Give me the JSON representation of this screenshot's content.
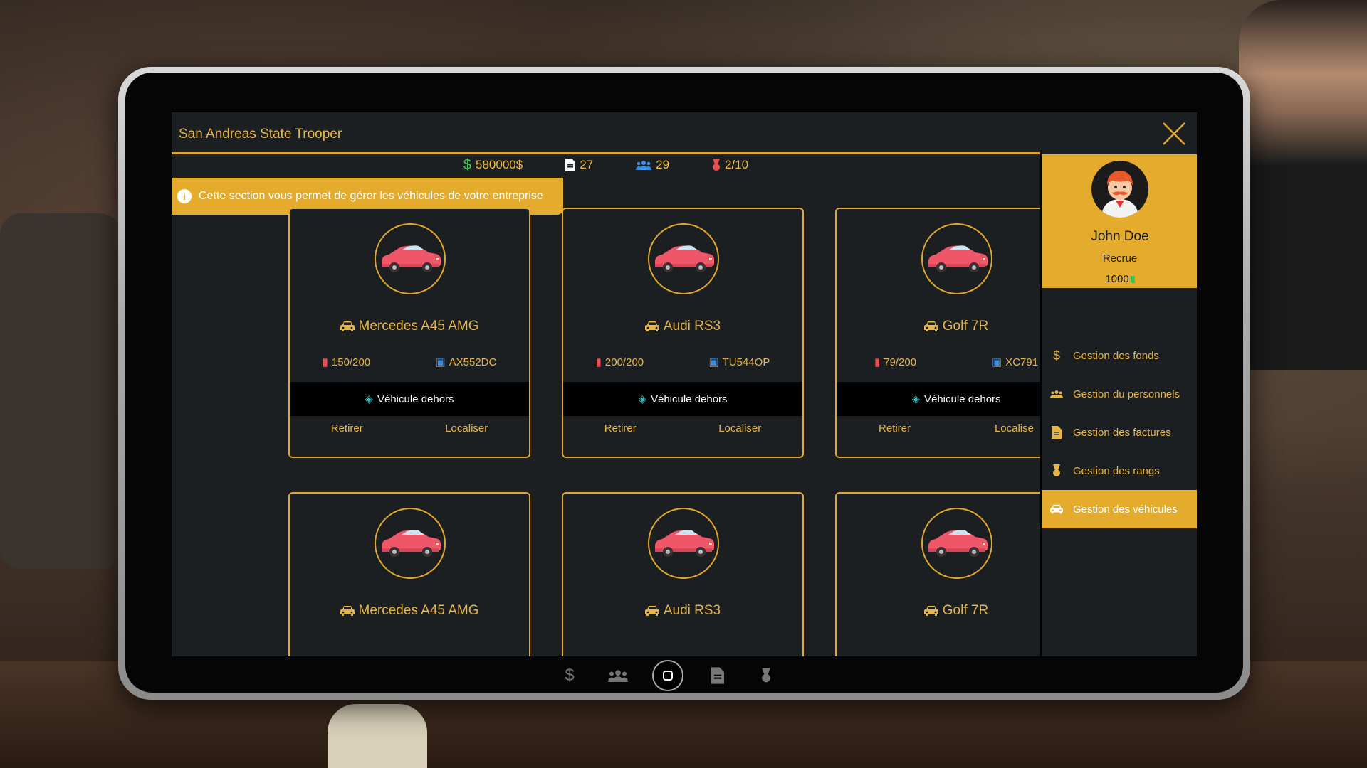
{
  "app": {
    "title": "San Andreas State Trooper"
  },
  "stats": {
    "money": "580000$",
    "invoices": "27",
    "employees": "29",
    "ranks": "2/10"
  },
  "info_banner": "Cette section vous permet de gérer les véhicules de votre entreprise",
  "profile": {
    "name": "John Doe",
    "rank": "Recrue",
    "xp": "1000"
  },
  "menu": [
    {
      "label": "Gestion des fonds",
      "icon": "dollar-icon"
    },
    {
      "label": "Gestion du personnels",
      "icon": "users-icon"
    },
    {
      "label": "Gestion des factures",
      "icon": "document-icon"
    },
    {
      "label": "Gestion des rangs",
      "icon": "medal-icon"
    },
    {
      "label": "Gestion des véhicules",
      "icon": "car-icon",
      "active": true
    }
  ],
  "vehicles": [
    {
      "name": "Mercedes A45 AMG",
      "fuel": "150/200",
      "plate": "AX552DC",
      "status": "Véhicule dehors",
      "retire": "Retirer",
      "locate": "Localiser"
    },
    {
      "name": "Audi RS3",
      "fuel": "200/200",
      "plate": "TU544OP",
      "status": "Véhicule dehors",
      "retire": "Retirer",
      "locate": "Localiser"
    },
    {
      "name": "Golf 7R",
      "fuel": "79/200",
      "plate": "XC791",
      "status": "Véhicule dehors",
      "retire": "Retirer",
      "locate": "Localise"
    },
    {
      "name": "Mercedes A45 AMG"
    },
    {
      "name": "Audi RS3"
    },
    {
      "name": "Golf 7R"
    }
  ],
  "colors": {
    "accent": "#e4ab2d",
    "panel": "#1c1f22",
    "fuel": "#e65050",
    "plate": "#3b8ee6",
    "money": "#3fc552",
    "status_dot": "#2fb7b0"
  }
}
